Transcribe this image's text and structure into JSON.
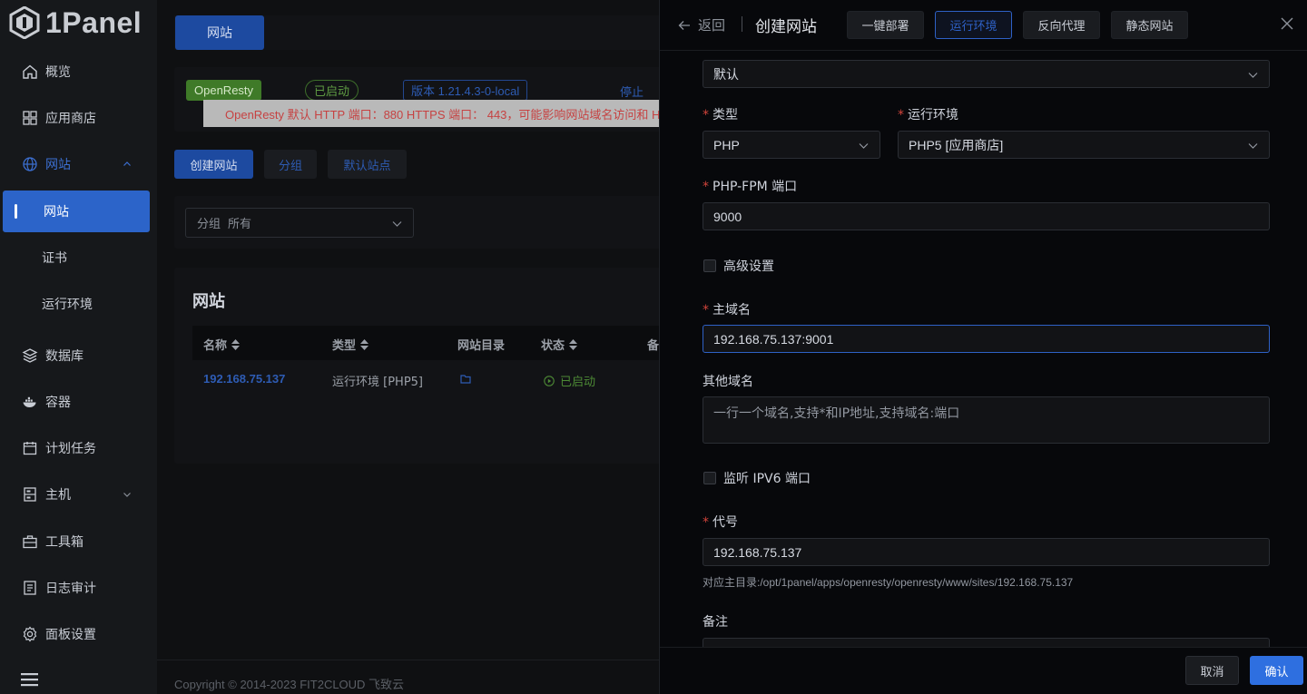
{
  "app": {
    "logo_text": "1Panel"
  },
  "sidebar": {
    "items": [
      {
        "label": "概览",
        "icon": "home-icon"
      },
      {
        "label": "应用商店",
        "icon": "grid-icon"
      },
      {
        "label": "网站",
        "icon": "globe-icon",
        "expanded": true
      },
      {
        "label": "数据库",
        "icon": "layers-icon"
      },
      {
        "label": "容器",
        "icon": "docker-icon"
      },
      {
        "label": "计划任务",
        "icon": "calendar-icon"
      },
      {
        "label": "主机",
        "icon": "server-icon"
      },
      {
        "label": "工具箱",
        "icon": "toolbox-icon"
      },
      {
        "label": "日志审计",
        "icon": "log-icon"
      },
      {
        "label": "面板设置",
        "icon": "gear-icon"
      }
    ],
    "website_sub": [
      "网站",
      "证书",
      "运行环境"
    ],
    "active_sub": "网站"
  },
  "main": {
    "tab_label": "网站",
    "status": {
      "app_tag": "OpenResty",
      "run_tag": "已启动",
      "version_tag": "版本 1.21.4.3-0-local",
      "stop_link": "停止",
      "warning": "OpenResty 默认 HTTP 端口：880 HTTPS 端口： 443，可能影响网站域名访问和 HT"
    },
    "buttons": {
      "create": "创建网站",
      "group": "分组",
      "default_site": "默认站点"
    },
    "filter": {
      "label": "分组",
      "value": "所有"
    },
    "table": {
      "title": "网站",
      "columns": [
        "名称",
        "类型",
        "网站目录",
        "状态",
        "备"
      ],
      "rows": [
        {
          "name": "192.168.75.137",
          "type": "运行环境 [PHP5]",
          "status": "已启动"
        }
      ]
    },
    "footer": "Copyright © 2014-2023 FIT2CLOUD 飞致云"
  },
  "drawer": {
    "back_label": "返回",
    "title": "创建网站",
    "tabs": [
      "一键部署",
      "运行环境",
      "反向代理",
      "静态网站"
    ],
    "active_tab": "运行环境",
    "group_value": "默认",
    "type_label": "类型",
    "type_value": "PHP",
    "runtime_label": "运行环境",
    "runtime_value": "PHP5 [应用商店]",
    "fpm_label": "PHP-FPM 端口",
    "fpm_value": "9000",
    "advanced_label": "高级设置",
    "domain_label": "主域名",
    "domain_value": "192.168.75.137:9001",
    "other_domains_label": "其他域名",
    "other_domains_placeholder": "一行一个域名,支持*和IP地址,支持域名:端口",
    "ipv6_label": "监听 IPV6 端口",
    "alias_label": "代号",
    "alias_value": "192.168.75.137",
    "alias_hint": "对应主目录:/opt/1panel/apps/openresty/openresty/www/sites/192.168.75.137",
    "remark_label": "备注",
    "cancel": "取消",
    "confirm": "确认"
  },
  "colors": {
    "primary": "#2e6fe0",
    "success": "#4d8a35",
    "danger": "#d2443b"
  }
}
